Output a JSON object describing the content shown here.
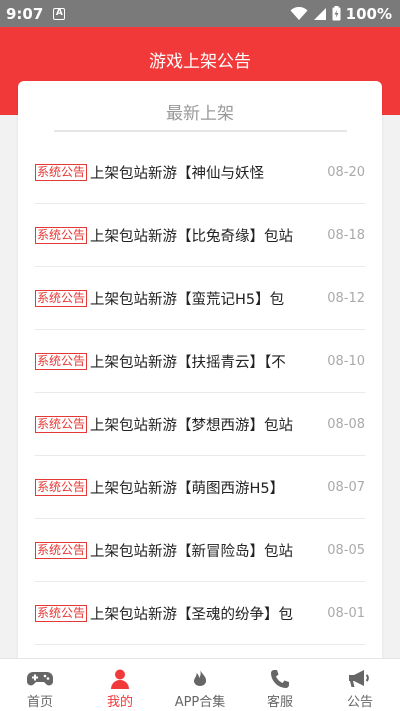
{
  "status_bar": {
    "time": "9:07",
    "notification_icon": "A",
    "battery": "100%"
  },
  "header": {
    "title": "游戏上架公告"
  },
  "card": {
    "title": "最新上架",
    "items": [
      {
        "badge": "系统公告",
        "title": "上架包站新游【神仙与妖怪",
        "date": "08-20"
      },
      {
        "badge": "系统公告",
        "title": "上架包站新游【比兔奇缘】包站",
        "date": "08-18"
      },
      {
        "badge": "系统公告",
        "title": "上架包站新游【蛮荒记H5】包",
        "date": "08-12"
      },
      {
        "badge": "系统公告",
        "title": "上架包站新游【扶摇青云】【不",
        "date": "08-10"
      },
      {
        "badge": "系统公告",
        "title": "上架包站新游【梦想西游】包站",
        "date": "08-08"
      },
      {
        "badge": "系统公告",
        "title": "上架包站新游【萌图西游H5】",
        "date": "08-07"
      },
      {
        "badge": "系统公告",
        "title": "上架包站新游【新冒险岛】包站",
        "date": "08-05"
      },
      {
        "badge": "系统公告",
        "title": "上架包站新游【圣魂的纷争】包",
        "date": "08-01"
      }
    ]
  },
  "bottom_nav": {
    "items": [
      {
        "label": "首页",
        "icon": "gamepad-icon",
        "active": false
      },
      {
        "label": "我的",
        "icon": "user-icon",
        "active": true
      },
      {
        "label": "APP合集",
        "icon": "flame-icon",
        "active": false
      },
      {
        "label": "客服",
        "icon": "phone-icon",
        "active": false
      },
      {
        "label": "公告",
        "icon": "megaphone-icon",
        "active": false
      }
    ]
  },
  "colors": {
    "accent": "#f2393a",
    "badge": "#e53935",
    "date": "#aaaaaa"
  }
}
